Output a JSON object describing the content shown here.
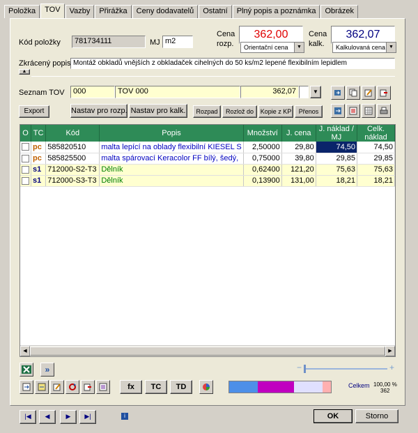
{
  "tabs": [
    "Položka",
    "TOV",
    "Vazby",
    "Přirážka",
    "Ceny dodavatelů",
    "Ostatní",
    "Plný popis a poznámka",
    "Obrázek"
  ],
  "item": {
    "code_label": "Kód položky",
    "code": "781734111",
    "mj_label": "MJ",
    "mj": "m2",
    "price1_label_a": "Cena",
    "price1_label_b": "rozp.",
    "price1": "362,00",
    "price1_type": "Orientační cena",
    "price2_label_a": "Cena",
    "price2_label_b": "kalk.",
    "price2": "362,07",
    "price2_type": "Kalkulovaná cena",
    "short_label": "Zkrácený popis",
    "short_desc": "Montáž obkladů vnějších z obkladaček cihelných do 50 ks/m2 lepené flexibilním lepidlem"
  },
  "tov": {
    "label": "Seznam TOV",
    "code": "000",
    "name": "TOV 000",
    "value": "362,07"
  },
  "buttons": {
    "export": "Export",
    "nastav_rozp": "Nastav pro rozp.",
    "nastav_kalk": "Nastav pro kalk.",
    "rozpad": "Rozpad",
    "rozloz": "Rozlož do",
    "kopie": "Kopie z KP",
    "prenos": "Přenos",
    "fx": "fx",
    "tc": "TC",
    "td": "TD",
    "ok": "OK",
    "storno": "Storno"
  },
  "grid": {
    "columns": [
      "O",
      "TC",
      "Kód",
      "Popis",
      "Množství",
      "J. cena",
      "J. náklad / MJ",
      "Celk. náklad"
    ],
    "rows": [
      {
        "tc": "pc",
        "code": "585820510",
        "desc": "malta lepící na oblady flexibilní KIESEL S",
        "qty": "2,50000",
        "price": "29,80",
        "unit_cost": "74,50",
        "total": "74,50"
      },
      {
        "tc": "pc",
        "code": "585825500",
        "desc": "malta spárovací Keracolor FF bílý, šedý,",
        "qty": "0,75000",
        "price": "39,80",
        "unit_cost": "29,85",
        "total": "29,85"
      },
      {
        "tc": "s1",
        "code": "712000-S2-T3",
        "desc": "Dělník",
        "qty": "0,62400",
        "price": "121,20",
        "unit_cost": "75,63",
        "total": "75,63"
      },
      {
        "tc": "s1",
        "code": "712000-S3-T3",
        "desc": "Dělník",
        "qty": "0,13900",
        "price": "131,00",
        "unit_cost": "18,21",
        "total": "18,21"
      }
    ]
  },
  "summary": {
    "label": "Celkem",
    "percent": "100,00 %",
    "value": "362"
  },
  "colors": {
    "header_green": "#2e8b57",
    "price1": "#e00000",
    "price2": "#000080"
  }
}
